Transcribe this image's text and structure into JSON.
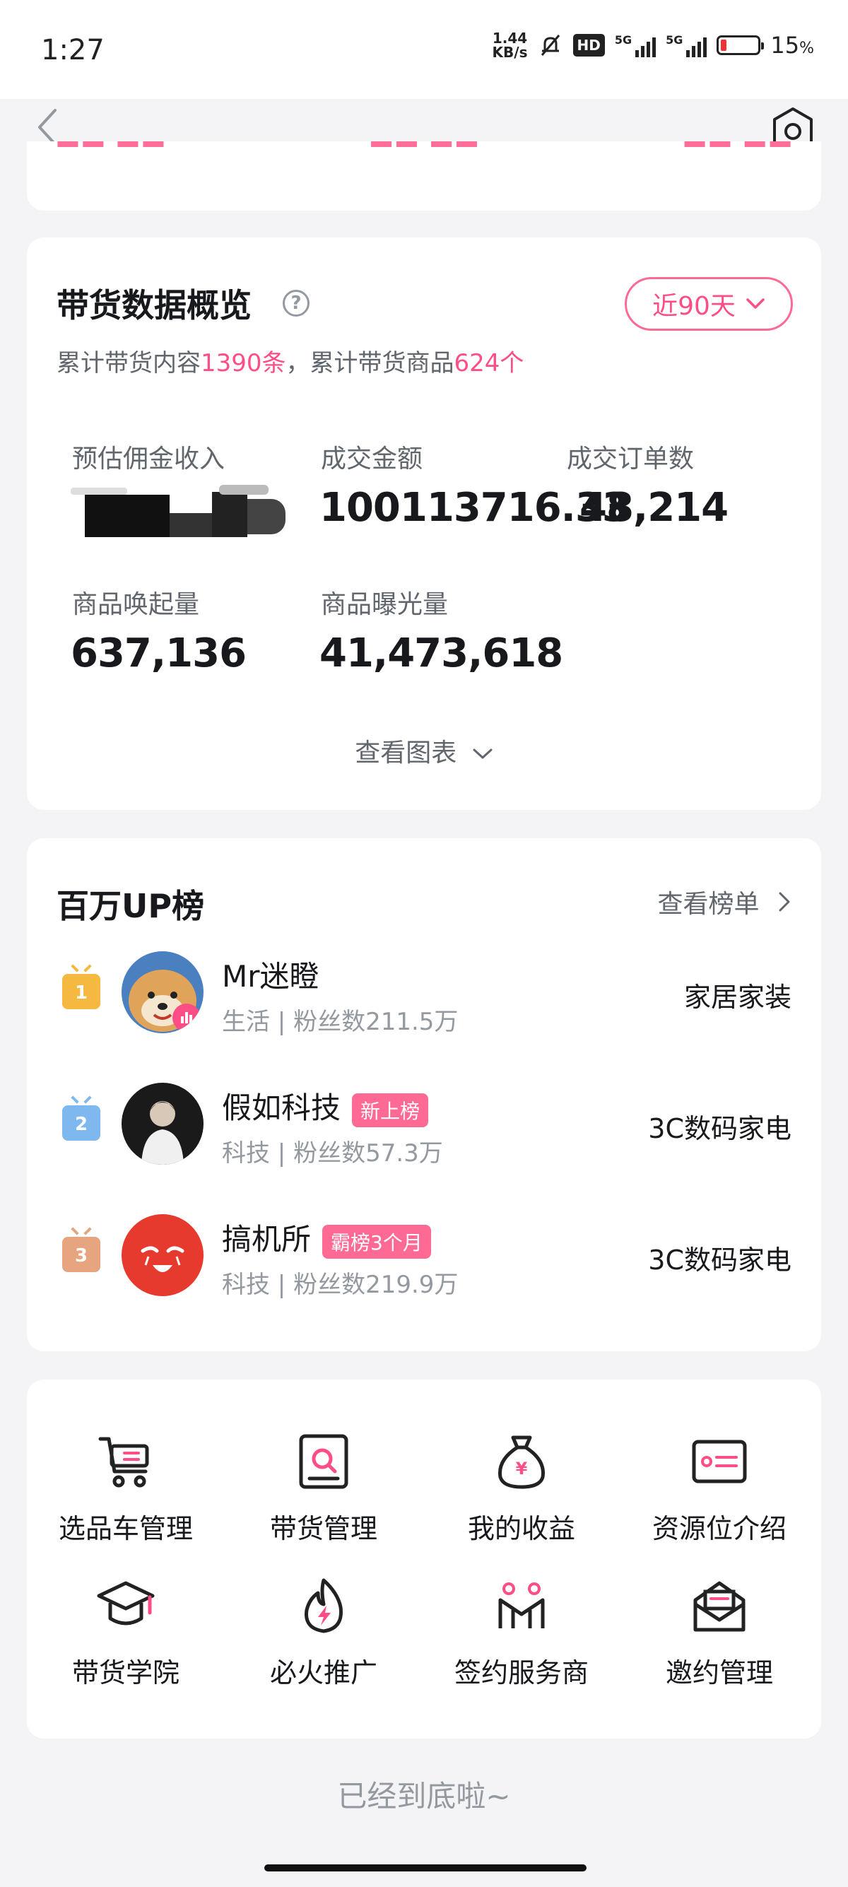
{
  "status_bar": {
    "time": "1:27",
    "net_speed_value": "1.44",
    "net_speed_unit": "KB/s",
    "hd_badge": "HD",
    "signal1_label": "5G",
    "signal2_label": "5G",
    "battery_percent": "15",
    "battery_symbol": "%",
    "battery_level": 0.15
  },
  "nav": {
    "back_icon": "chevron-left-icon",
    "settings_icon": "gear-icon"
  },
  "overview": {
    "title": "带货数据概览",
    "help_symbol": "?",
    "range_label": "近90天",
    "summary_prefix": "累计带货内容",
    "content_count": "1390条",
    "summary_mid": "，累计带货商品",
    "product_count": "624个",
    "metrics": [
      {
        "label": "预估佣金收入",
        "value": ""
      },
      {
        "label": "成交金额",
        "value": "100113716.33"
      },
      {
        "label": "成交订单数",
        "value": "48,214"
      },
      {
        "label": "商品唤起量",
        "value": "637,136"
      },
      {
        "label": "商品曝光量",
        "value": "41,473,618"
      }
    ],
    "view_chart": "查看图表"
  },
  "ranking": {
    "title": "百万UP榜",
    "more": "查看榜单",
    "items": [
      {
        "rank": "1",
        "name": "Mr迷瞪",
        "tag": "",
        "meta": "生活 | 粉丝数211.5万",
        "category": "家居家装",
        "badge_color": "#f5b942"
      },
      {
        "rank": "2",
        "name": "假如科技",
        "tag": "新上榜",
        "meta": "科技 | 粉丝数57.3万",
        "category": "3C数码家电",
        "badge_color": "#7fb8ef"
      },
      {
        "rank": "3",
        "name": "搞机所",
        "tag": "霸榜3个月",
        "meta": "科技 | 粉丝数219.9万",
        "category": "3C数码家电",
        "badge_color": "#e6a57e"
      }
    ]
  },
  "tools": [
    {
      "label": "选品车管理",
      "icon": "cart-icon"
    },
    {
      "label": "带货管理",
      "icon": "search-box-icon"
    },
    {
      "label": "我的收益",
      "icon": "money-bag-icon"
    },
    {
      "label": "资源位介绍",
      "icon": "card-icon"
    },
    {
      "label": "带货学院",
      "icon": "graduation-cap-icon"
    },
    {
      "label": "必火推广",
      "icon": "fire-icon"
    },
    {
      "label": "签约服务商",
      "icon": "partners-icon"
    },
    {
      "label": "邀约管理",
      "icon": "mail-icon"
    }
  ],
  "footer": "已经到底啦~"
}
